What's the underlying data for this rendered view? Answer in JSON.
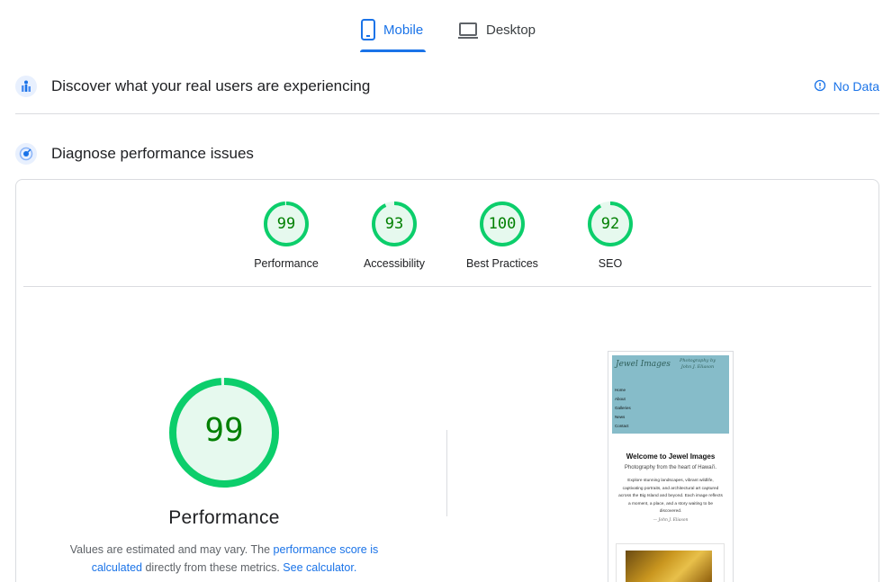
{
  "tabs": {
    "mobile": {
      "label": "Mobile",
      "icon": "smartphone-icon"
    },
    "desktop": {
      "label": "Desktop",
      "icon": "laptop-icon"
    }
  },
  "field_section": {
    "title": "Discover what your real users are experiencing",
    "icon": "users-experience-icon",
    "status_label": "No Data",
    "status_icon": "info-icon"
  },
  "lab_section": {
    "title": "Diagnose performance issues",
    "icon": "lighthouse-icon"
  },
  "categories": [
    {
      "label": "Performance",
      "score": "99"
    },
    {
      "label": "Accessibility",
      "score": "93"
    },
    {
      "label": "Best Practices",
      "score": "100"
    },
    {
      "label": "SEO",
      "score": "92"
    }
  ],
  "performance": {
    "score": "99",
    "title": "Performance",
    "desc_prefix": "Values are estimated and may vary. The ",
    "desc_link": "performance score is calculated",
    "desc_middle": " directly from these metrics. ",
    "desc_calc_link": "See calculator."
  },
  "screenshot": {
    "logo": "Jewel Images",
    "byline": "Photography by John J. Eliason",
    "nav": [
      "Home",
      "About",
      "Galleries",
      "News",
      "Contact"
    ],
    "heading": "Welcome to Jewel Images",
    "subheading": "Photography from the heart of Hawai'i.",
    "body": "Explore stunning landscapes, vibrant wildlife, captivating portraits, and architectural art captured across the Big Island and beyond. Each image reflects a moment, a place, and a story waiting to be discovered.",
    "signature": "— John J. Eliason"
  },
  "colors": {
    "accent": "#1a73e8",
    "pass_green": "#0cce6b",
    "pass_fill": "#e6f9ee",
    "score_text": "#008000"
  }
}
